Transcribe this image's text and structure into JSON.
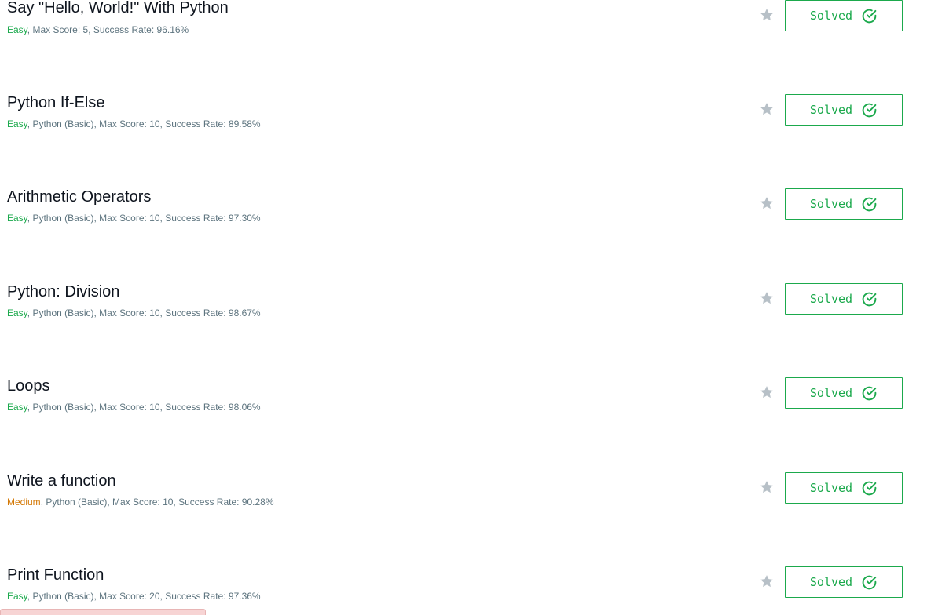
{
  "challenges": [
    {
      "title": "Say \"Hello, World!\" With Python",
      "difficulty": "Easy",
      "difficulty_key": "easy",
      "meta": ", Max Score: 5, Success Rate: 96.16%",
      "status": "Solved"
    },
    {
      "title": "Python If-Else",
      "difficulty": "Easy",
      "difficulty_key": "easy",
      "meta": ", Python (Basic), Max Score: 10, Success Rate: 89.58%",
      "status": "Solved"
    },
    {
      "title": "Arithmetic Operators",
      "difficulty": "Easy",
      "difficulty_key": "easy",
      "meta": ", Python (Basic), Max Score: 10, Success Rate: 97.30%",
      "status": "Solved"
    },
    {
      "title": "Python: Division",
      "difficulty": "Easy",
      "difficulty_key": "easy",
      "meta": ", Python (Basic), Max Score: 10, Success Rate: 98.67%",
      "status": "Solved"
    },
    {
      "title": "Loops",
      "difficulty": "Easy",
      "difficulty_key": "easy",
      "meta": ", Python (Basic), Max Score: 10, Success Rate: 98.06%",
      "status": "Solved"
    },
    {
      "title": "Write a function",
      "difficulty": "Medium",
      "difficulty_key": "medium",
      "meta": ", Python (Basic), Max Score: 10, Success Rate: 90.28%",
      "status": "Solved"
    },
    {
      "title": "Print Function",
      "difficulty": "Easy",
      "difficulty_key": "easy",
      "meta": ", Python (Basic), Max Score: 20, Success Rate: 97.36%",
      "status": "Solved"
    }
  ],
  "icons": {
    "star": "star-icon",
    "check": "check-circle-icon"
  },
  "colors": {
    "easy": "#1ba94c",
    "medium": "#d47906",
    "meta": "#5c737e",
    "solved": "#1ba94c",
    "star": "#b7c0c7"
  }
}
